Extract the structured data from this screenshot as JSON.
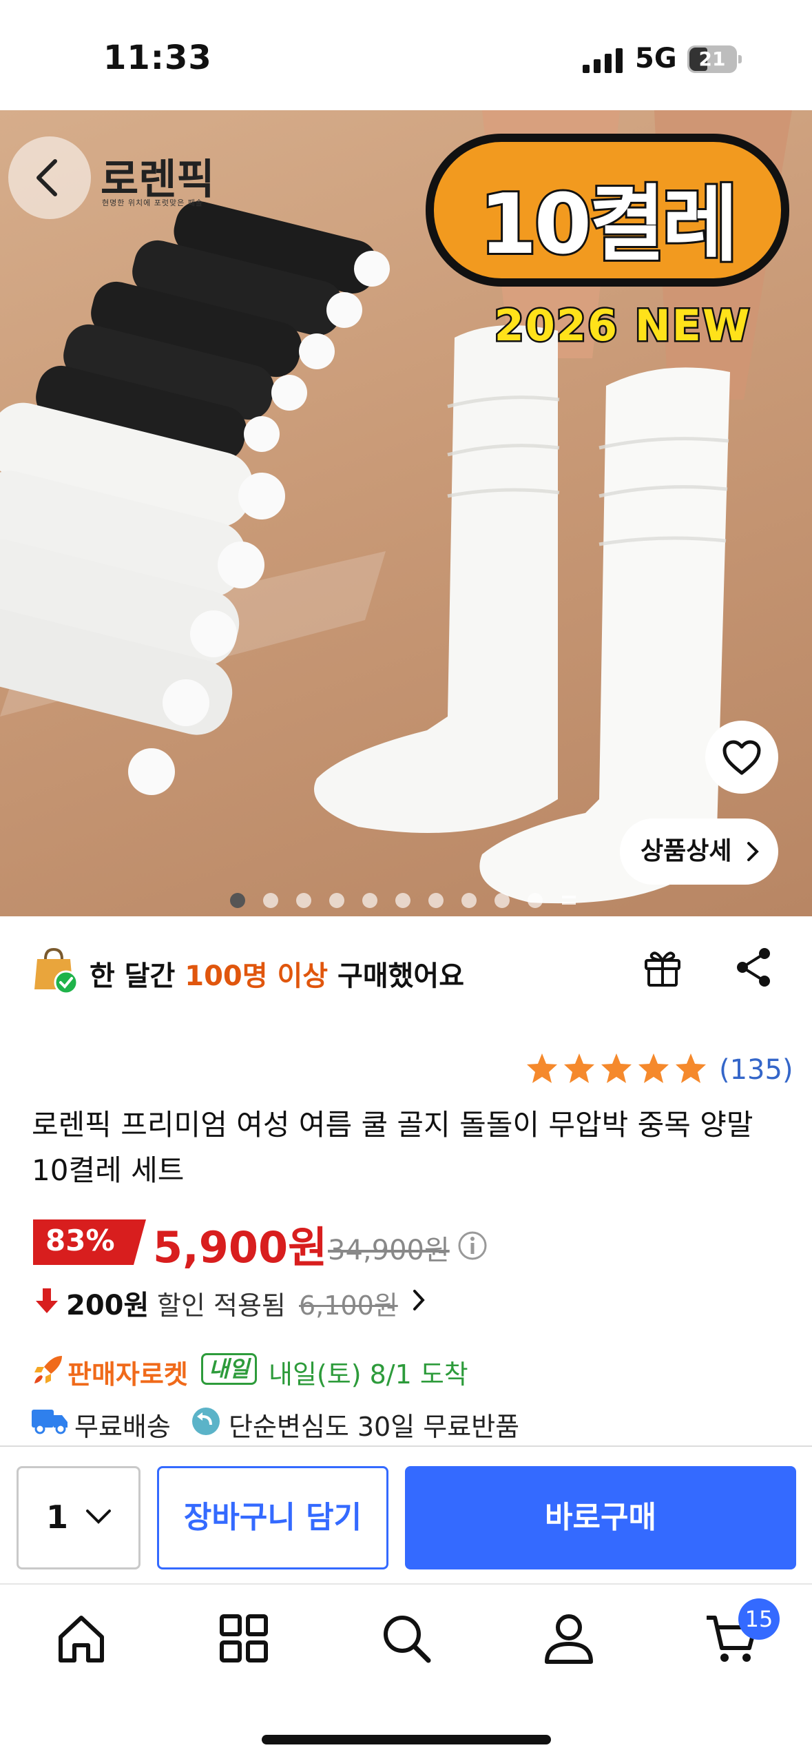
{
  "status_bar": {
    "time": "11:33",
    "network": "5G",
    "battery": "21"
  },
  "hero": {
    "brand": "로렌픽",
    "brand_tagline": "현명한 위치에 포럿맞은 패솔",
    "badge_count": "10켤레",
    "badge_new": "2026 NEW",
    "detail_button": "상품상세",
    "image_count": 10,
    "active_image_index": 0
  },
  "purchase_info": {
    "prefix": "한 달간 ",
    "highlight": "100명 이상",
    "suffix": " 구매했어요"
  },
  "rating": {
    "stars": 5,
    "count": "(135)"
  },
  "product": {
    "title": "로렌픽 프리미엄 여성 여름 쿨 골지 돌돌이 무압박 중목 양말 10켤레 세트"
  },
  "price": {
    "discount": "83%",
    "current": "5,900원",
    "original": "34,900원",
    "coupon_amount": "200원",
    "coupon_label": "할인 적용됨",
    "coupon_original": "6,100원"
  },
  "delivery": {
    "rocket_label": "판매자로켓",
    "tomorrow_tag": "내일",
    "arrival": "내일(토) 8/1 도착",
    "shipping": "무료배송",
    "returns": "단순변심도 30일 무료반품"
  },
  "action_bar": {
    "quantity": "1",
    "cart_button": "장바구니 담기",
    "buy_button": "바로구매"
  },
  "tab_bar": {
    "cart_badge": "15"
  },
  "colors": {
    "accent_blue": "#346aff",
    "price_red": "#d81e1e",
    "highlight_orange": "#e0560d",
    "delivery_green": "#2d9b3b"
  },
  "icons": [
    "back-icon",
    "heart-icon",
    "shopping-bag-icon",
    "gift-icon",
    "share-icon",
    "star-icon",
    "info-icon",
    "down-arrow-icon",
    "rocket-icon",
    "truck-icon",
    "return-icon",
    "home-icon",
    "category-icon",
    "search-icon",
    "user-icon",
    "cart-icon"
  ]
}
